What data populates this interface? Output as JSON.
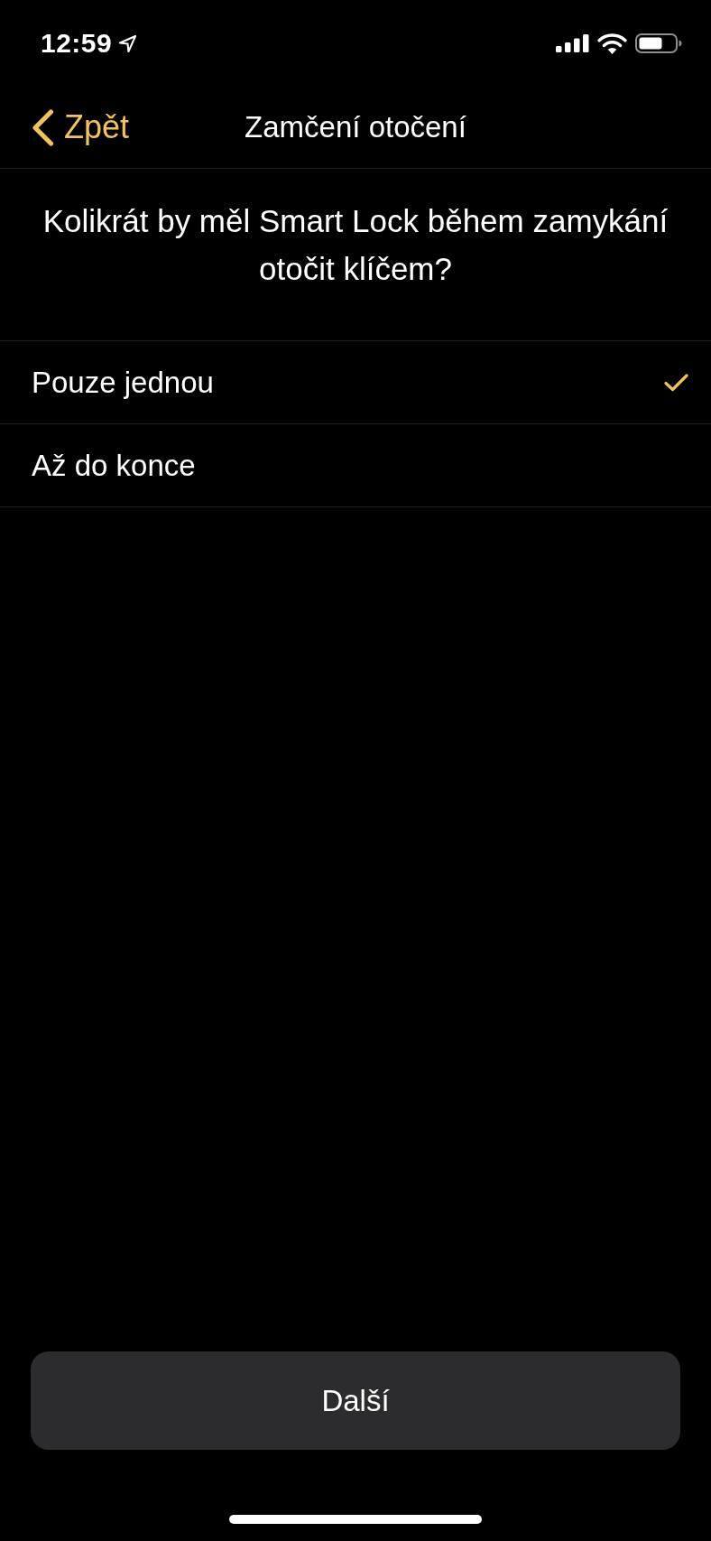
{
  "status_bar": {
    "time": "12:59"
  },
  "nav": {
    "back": "Zpět",
    "title": "Zamčení otočení"
  },
  "question": "Kolikrát by měl Smart Lock během zamykání otočit klíčem?",
  "options": [
    {
      "label": "Pouze jednou",
      "selected": true
    },
    {
      "label": "Až do konce",
      "selected": false
    }
  ],
  "button": {
    "label": "Další"
  }
}
